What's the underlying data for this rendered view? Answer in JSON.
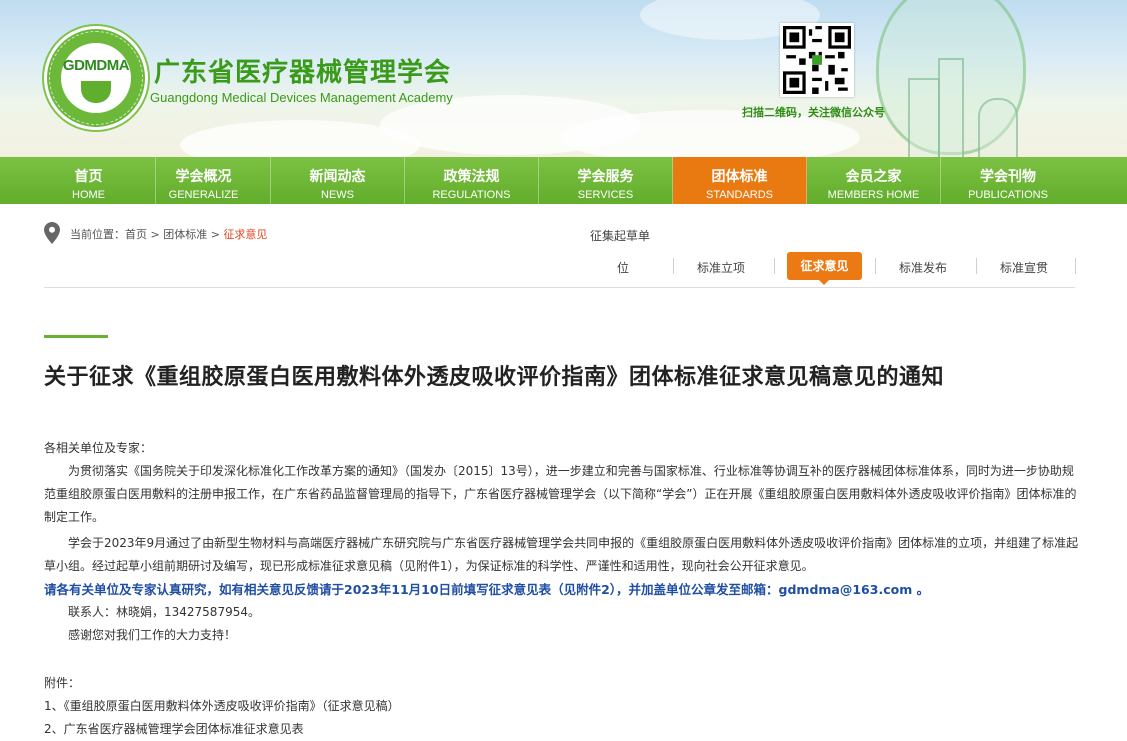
{
  "header": {
    "logo_text": "GDMDMA",
    "title_cn": "广东省医疗器械管理学会",
    "title_en": "Guangdong Medical Devices Management Academy",
    "qr_caption": "扫描二维码，关注微信公众号"
  },
  "nav": [
    {
      "cn": "首页",
      "en": "HOME",
      "active": false
    },
    {
      "cn": "学会概况",
      "en": "GENERALIZE",
      "active": false
    },
    {
      "cn": "新闻动态",
      "en": "NEWS",
      "active": false
    },
    {
      "cn": "政策法规",
      "en": "REGULATIONS",
      "active": false
    },
    {
      "cn": "学会服务",
      "en": "SERVICES",
      "active": false
    },
    {
      "cn": "团体标准",
      "en": "STANDARDS",
      "active": true
    },
    {
      "cn": "会员之家",
      "en": "MEMBERS HOME",
      "active": false
    },
    {
      "cn": "学会刊物",
      "en": "PUBLICATIONS",
      "active": false
    }
  ],
  "breadcrumb": {
    "prefix": "当前位置：",
    "home": "首页",
    "sep": " > ",
    "section": "团体标准",
    "current": "征求意见"
  },
  "subnav": {
    "item1_line1": "征集起草单",
    "item1_line2": "位",
    "item2": "标准立项",
    "item3_active": "征求意见",
    "item4": "标准发布",
    "item5": "标准宣贯"
  },
  "colors": {
    "brand_green": "#68b02f",
    "active_orange": "#ec7a14",
    "emphasis_blue": "#1f4ea3",
    "breadcrumb_current": "#e0451f"
  },
  "article": {
    "title": "关于征求《重组胶原蛋白医用敷料体外透皮吸收评价指南》团体标准征求意见稿意见的通知",
    "salutation": "各相关单位及专家：",
    "p1": "为贯彻落实《国务院关于印发深化标准化工作改革方案的通知》（国发办〔2015〕13号），进一步建立和完善与国家标准、行业标准等协调互补的医疗器械团体标准体系，同时为进一步协助规范重组胶原蛋白医用敷料的注册申报工作，在广东省药品监督管理局的指导下，广东省医疗器械管理学会（以下简称“学会”）正在开展《重组胶原蛋白医用敷料体外透皮吸收评价指南》团体标准的制定工作。",
    "p2": "学会于2023年9月通过了由新型生物材料与高端医疗器械广东研究院与广东省医疗器械管理学会共同申报的《重组胶原蛋白医用敷料体外透皮吸收评价指南》团体标准的立项，并组建了标准起草小组。经过起草小组前期研讨及编写，现已形成标准征求意见稿（见附件1），为保证标准的科学性、严谨性和适用性，现向社会公开征求意见。",
    "p3_bold": "请各有关单位及专家认真研究，如有相关意见反馈请于2023年11月10日前填写征求意见表（见附件2），并加盖单位公章发至邮箱：gdmdma@163.com  。",
    "contact": "联系人：林晓娟，13427587954。",
    "thanks": "感谢您对我们工作的大力支持！",
    "attachments_label": "附件：",
    "attachment1": "1、《重组胶原蛋白医用敷料体外透皮吸收评价指南》（征求意见稿）",
    "attachment2": "2、广东省医疗器械管理学会团体标准征求意见表"
  }
}
